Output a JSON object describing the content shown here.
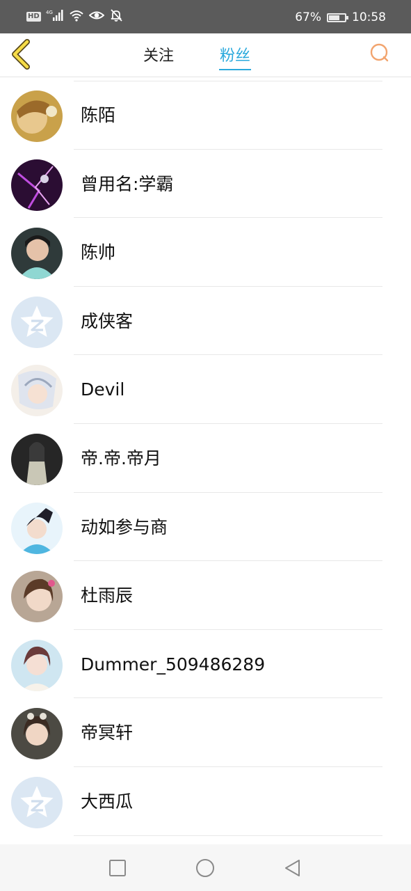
{
  "status_bar": {
    "hd": "HD",
    "net": "4G",
    "battery_percent": "67%",
    "battery_level": 0.67,
    "time": "10:58",
    "icons": [
      "hd-icon",
      "signal-icon",
      "wifi-icon",
      "eye-icon",
      "bell-off-icon",
      "battery-icon"
    ]
  },
  "header": {
    "tabs": [
      {
        "label": "关注",
        "active": false
      },
      {
        "label": "粉丝",
        "active": true
      }
    ],
    "accent_color": "#2aa9dc",
    "back_icon": "chevron-left-icon",
    "search_icon": "search-icon"
  },
  "fans": [
    {
      "name": "陈陌",
      "avatar": "photo"
    },
    {
      "name": "曾用名:学霸",
      "avatar": "photo"
    },
    {
      "name": "陈帅",
      "avatar": "photo"
    },
    {
      "name": "成侠客",
      "avatar": "default-qzone"
    },
    {
      "name": "Devil",
      "avatar": "photo"
    },
    {
      "name": "帝.帝.帝月",
      "avatar": "photo"
    },
    {
      "name": "动如参与商",
      "avatar": "photo"
    },
    {
      "name": "杜雨辰",
      "avatar": "photo"
    },
    {
      "name": "Dummer_509486289",
      "avatar": "photo"
    },
    {
      "name": "帝冥轩",
      "avatar": "photo"
    },
    {
      "name": "大西瓜",
      "avatar": "default-qzone"
    }
  ],
  "nav_bar": {
    "icons": [
      "recents-square-icon",
      "home-circle-icon",
      "back-triangle-icon"
    ]
  }
}
